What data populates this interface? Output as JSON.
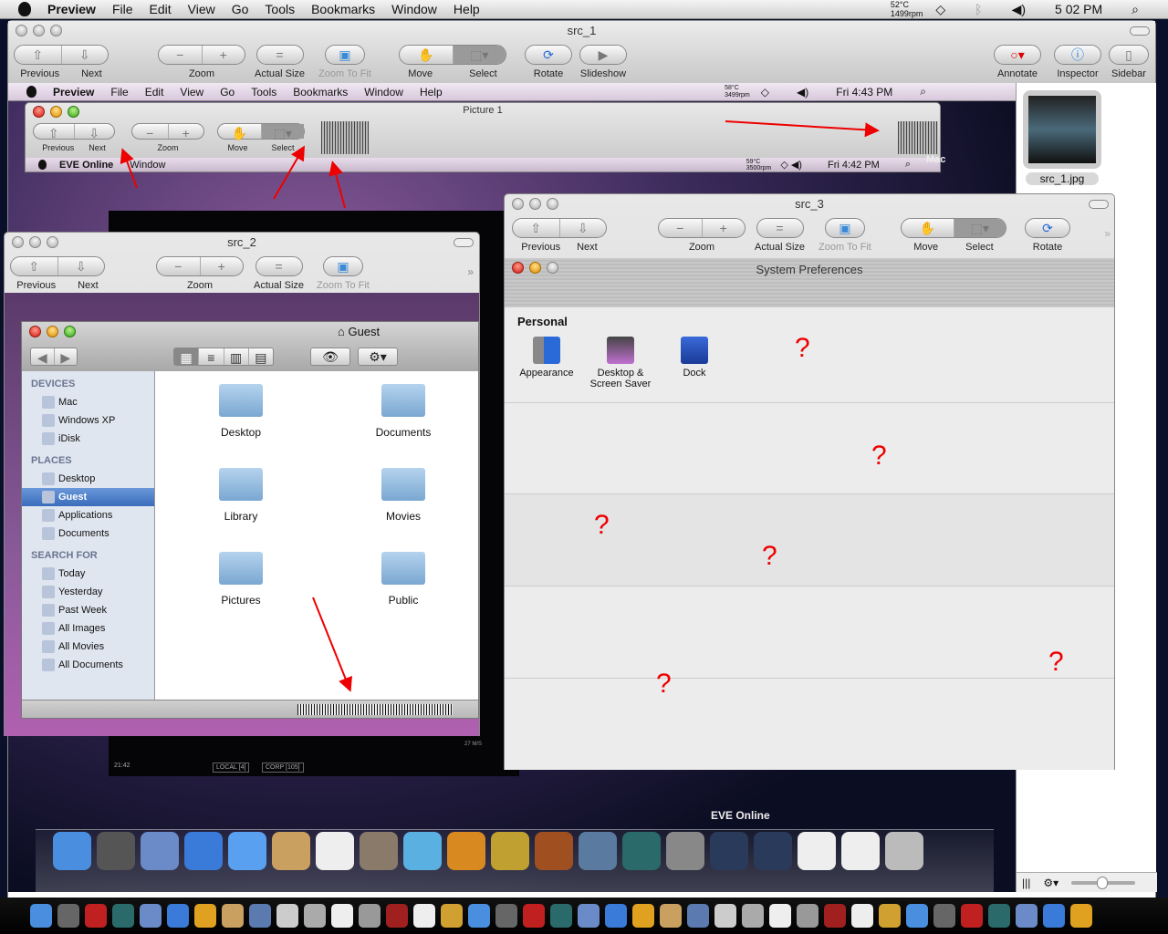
{
  "menubar": {
    "app": "Preview",
    "items": [
      "File",
      "Edit",
      "View",
      "Go",
      "Tools",
      "Bookmarks",
      "Window",
      "Help"
    ],
    "temp": "52°C",
    "rpm": "1499rpm",
    "clock": "5 02 PM"
  },
  "src1": {
    "title": "src_1",
    "toolbar": {
      "previous": "Previous",
      "next": "Next",
      "zoom": "Zoom",
      "actual_size": "Actual Size",
      "zoom_to_fit": "Zoom To Fit",
      "move": "Move",
      "select": "Select",
      "rotate": "Rotate",
      "slideshow": "Slideshow",
      "annotate": "Annotate",
      "inspector": "Inspector",
      "sidebar": "Sidebar"
    },
    "thumb_label": "src_1.jpg"
  },
  "inner_menubar": {
    "app": "Preview",
    "items": [
      "File",
      "Edit",
      "View",
      "Go",
      "Tools",
      "Bookmarks",
      "Window",
      "Help"
    ],
    "temp": "58°C",
    "rpm": "3499rpm",
    "clock": "Fri 4:43 PM"
  },
  "picture1": {
    "title": "Picture 1",
    "previous": "Previous",
    "next": "Next",
    "zoom": "Zoom",
    "move": "Move",
    "select": "Select",
    "mac_label": "Mac"
  },
  "eve_menubar": {
    "app": "EVE Online",
    "item": "Window",
    "temp": "59°C",
    "rpm": "3500rpm",
    "clock": "Fri 4:42 PM"
  },
  "eve_hud": {
    "local": "LOCAL [4]",
    "corp": "CORP [105]",
    "time": "21:42",
    "speed": "27 M/S"
  },
  "src2": {
    "title": "src_2",
    "previous": "Previous",
    "next": "Next",
    "zoom": "Zoom",
    "actual_size": "Actual Size",
    "zoom_to_fit": "Zoom To Fit"
  },
  "finder": {
    "title": "Guest",
    "sections": [
      {
        "label": "DEVICES",
        "items": [
          "Mac",
          "Windows XP",
          "iDisk"
        ]
      },
      {
        "label": "PLACES",
        "items": [
          "Desktop",
          "Guest",
          "Applications",
          "Documents"
        ]
      },
      {
        "label": "SEARCH FOR",
        "items": [
          "Today",
          "Yesterday",
          "Past Week",
          "All Images",
          "All Movies",
          "All Documents"
        ]
      }
    ],
    "folders": [
      "Desktop",
      "Documents",
      "Library",
      "Movies",
      "Pictures",
      "Public"
    ]
  },
  "src3": {
    "title": "src_3",
    "previous": "Previous",
    "next": "Next",
    "zoom": "Zoom",
    "actual_size": "Actual Size",
    "zoom_to_fit": "Zoom To Fit",
    "move": "Move",
    "select": "Select",
    "rotate": "Rotate"
  },
  "sysprefs": {
    "title": "System Preferences",
    "section": "Personal",
    "items": [
      "Appearance",
      "Desktop & Screen Saver",
      "Dock"
    ],
    "unknown_mark": "?"
  },
  "dock": {
    "tooltip": "EVE Online",
    "icons": [
      "finder",
      "dashboard",
      "mail",
      "safari",
      "ichat",
      "address-book",
      "ical",
      "iphoto",
      "itunes",
      "image-capture",
      "imovie",
      "garageband",
      "spaces",
      "time-machine",
      "system-preferences",
      "eve-online",
      "eve-online-2",
      "pdf-document",
      "pdf-document-2",
      "trash"
    ],
    "colors": [
      "#4a8ee0",
      "#555",
      "#6a8ac8",
      "#3a7ad8",
      "#5aa0f0",
      "#c9a060",
      "#eee",
      "#8a7a6a",
      "#5ab0e0",
      "#d88a20",
      "#c0a030",
      "#a05020",
      "#5a7aa0",
      "#2a6a6a",
      "#888",
      "#2a3a5a",
      "#2a3a5a",
      "#eee",
      "#eee",
      "#bbb"
    ]
  },
  "dock2": {
    "icons": [
      "finder",
      "dashboard",
      "chair-app",
      "time-machine",
      "mail",
      "safari",
      "network",
      "address-book",
      "preview",
      "ipod",
      "clock",
      "ical",
      "calculator",
      "dictionary",
      "textedit",
      "lamp",
      "disk-utility",
      "quicktime",
      "itunes",
      "garageband",
      "iphoto",
      "archive",
      "image-capture",
      "camera",
      "quicktime-2",
      "vlc",
      "reader",
      "mail-2",
      "xcode",
      "eve",
      "keynote",
      "scripteditor",
      "charts",
      "terminal",
      "activity-monitor",
      "installer",
      "update",
      "preview-2",
      "trash"
    ]
  }
}
